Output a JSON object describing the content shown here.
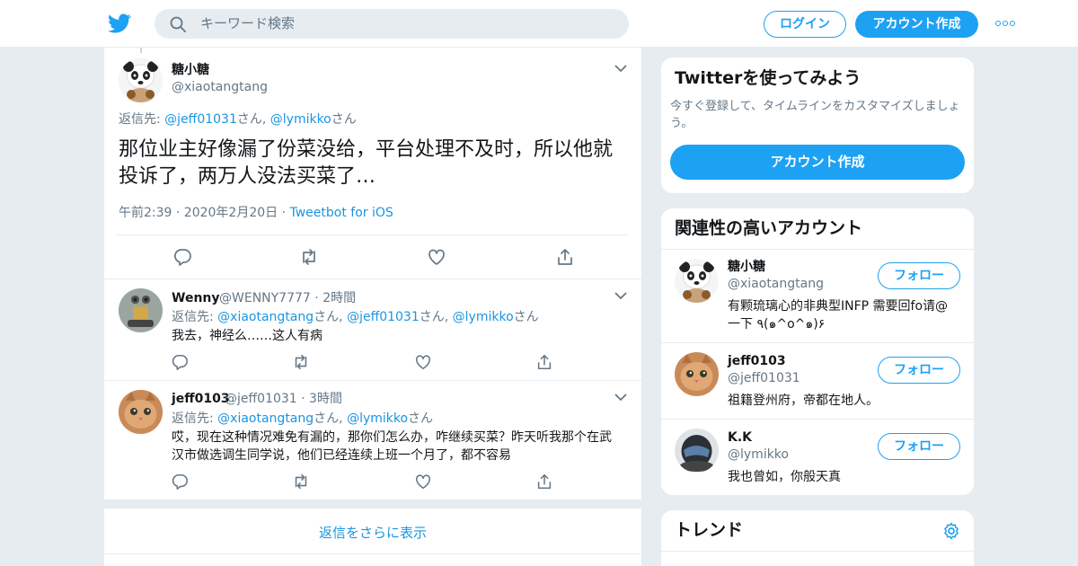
{
  "header": {
    "search_placeholder": "キーワード検索",
    "login_label": "ログイン",
    "signup_label": "アカウント作成",
    "brand_color": "#1da1f2"
  },
  "main_tweet": {
    "name": "糖小糖",
    "handle": "@xiaotangtang",
    "reply_prefix": "返信先: ",
    "reply_users": [
      "@jeff01031",
      "@lymikko"
    ],
    "reply_suffix": "さん",
    "text": "那位业主好像漏了份菜没给，平台处理不及时，所以他就投诉了，两万人没法买菜了…",
    "timestamp": "午前2:39 · 2020年2月20日 · ",
    "source": "Tweetbot for iOS"
  },
  "replies": [
    {
      "name": "Wenny",
      "handle": "@WENNY7777",
      "time": "2時間",
      "reply_users": [
        "@xiaotangtang",
        "@jeff01031",
        "@lymikko"
      ],
      "text": "我去，神经么……这人有病"
    },
    {
      "name": "jeff0103",
      "handle": "@jeff01031",
      "time": "3時間",
      "reply_users": [
        "@xiaotangtang",
        "@lymikko"
      ],
      "text": "哎，现在这种情况难免有漏的，那你们怎么办，咋继续买菜？昨天听我那个在武汉市做选调生同学说，他们已经连续上班一个月了，都不容易"
    }
  ],
  "show_more_replies": "返信をさらに表示",
  "sidebar": {
    "signup_card": {
      "title": "Twitterを使ってみよう",
      "desc": "今すぐ登録して、タイムラインをカスタマイズしましょう。",
      "button": "アカウント作成"
    },
    "related": {
      "title": "関連性の高いアカウント",
      "follow_label": "フォロー",
      "accounts": [
        {
          "name": "糖小糖",
          "handle": "@xiaotangtang",
          "bio": "有颗琉璃心的非典型INFP 需要回fo请@ 一下 ٩(๑^o^๑)۶"
        },
        {
          "name": "jeff0103",
          "handle": "@jeff01031",
          "bio": "祖籍登州府，帝都在地人。"
        },
        {
          "name": "K.K",
          "handle": "@lymikko",
          "bio": "我也曾如，你般天真"
        }
      ]
    },
    "trends": {
      "title": "トレンド"
    }
  }
}
